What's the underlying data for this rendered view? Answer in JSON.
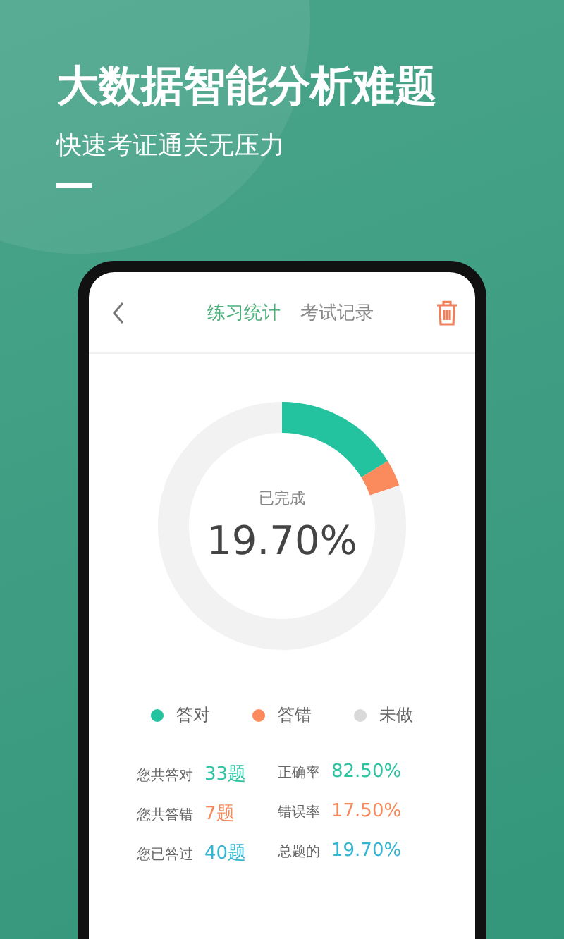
{
  "headline": "大数据智能分析难题",
  "subheadline": "快速考证通关无压力",
  "app": {
    "tabs": [
      {
        "label": "练习统计",
        "selected": true
      },
      {
        "label": "考试记录",
        "selected": false
      }
    ],
    "chart_data": {
      "type": "donut",
      "categories": [
        "答对",
        "答错",
        "未做"
      ],
      "values": [
        16.25,
        3.45,
        80.3
      ],
      "colors": [
        "#24c3a0",
        "#fb8a5c",
        "#f2f2f2"
      ]
    },
    "center_label": "已完成",
    "center_value": "19.70%",
    "legend": [
      {
        "color": "#24c3a0"
      },
      {
        "color": "#fb8a5c"
      },
      {
        "color": "#d9d9d9"
      }
    ],
    "stats": [
      {
        "label": "您共答对",
        "value": "33题",
        "color": "#2ec4a2"
      },
      {
        "label": "正确率",
        "value": "82.50%",
        "color": "#2ec4a2"
      },
      {
        "label": "您共答错",
        "value": "7题",
        "color": "#f5895c"
      },
      {
        "label": "错误率",
        "value": "17.50%",
        "color": "#f5895c"
      },
      {
        "label": "您已答过",
        "value": "40题",
        "color": "#35b5d4"
      },
      {
        "label": "总题的",
        "value": "19.70%",
        "color": "#35b5d4"
      }
    ]
  }
}
